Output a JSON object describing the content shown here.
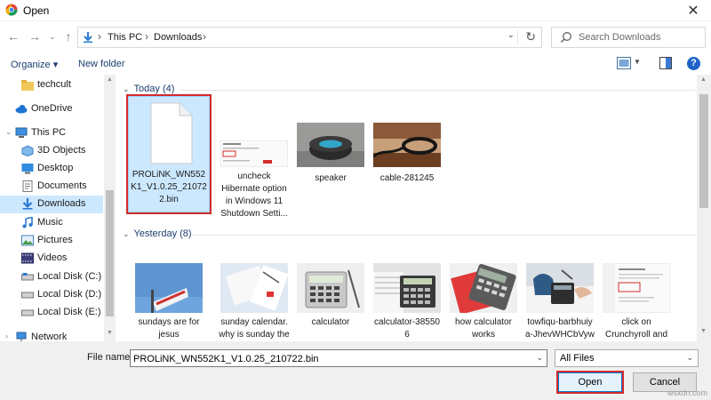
{
  "window": {
    "title": "Open",
    "close_label": "✕"
  },
  "nav": {
    "breadcrumbs": [
      "This PC",
      "Downloads"
    ],
    "search_placeholder": "Search Downloads"
  },
  "toolbar": {
    "organize": "Organize ▾",
    "new_folder": "New folder",
    "help": "?"
  },
  "sidebar": {
    "items": [
      {
        "label": "techcult",
        "icon": "folder-icon"
      },
      {
        "label": "OneDrive",
        "icon": "cloud-icon"
      },
      {
        "label": "This PC",
        "icon": "computer-icon"
      },
      {
        "label": "3D Objects",
        "icon": "cube-icon"
      },
      {
        "label": "Desktop",
        "icon": "desktop-icon"
      },
      {
        "label": "Documents",
        "icon": "document-icon"
      },
      {
        "label": "Downloads",
        "icon": "download-icon",
        "selected": true
      },
      {
        "label": "Music",
        "icon": "music-icon"
      },
      {
        "label": "Pictures",
        "icon": "picture-icon"
      },
      {
        "label": "Videos",
        "icon": "video-icon"
      },
      {
        "label": "Local Disk (C:)",
        "icon": "drive-icon"
      },
      {
        "label": "Local Disk (D:)",
        "icon": "drive-icon"
      },
      {
        "label": "Local Disk (E:)",
        "icon": "drive-icon"
      },
      {
        "label": "Network",
        "icon": "network-icon"
      }
    ]
  },
  "groups": [
    {
      "header": "Today (4)",
      "files": [
        {
          "name": "PROLiNK_WN552K1_V1.0.25_210722.bin",
          "name_lines": [
            "PROLiNK_WN552",
            "K1_V1.0.25_21072",
            "2.bin"
          ],
          "thumb": "file-icon",
          "selected": true
        },
        {
          "name": "uncheck Hibernate option in Windows 11 Shutdown Setti...",
          "name_lines": [
            "uncheck",
            "Hibernate option",
            "in Windows 11",
            "Shutdown Setti..."
          ],
          "thumb": "screenshot-thumbnail"
        },
        {
          "name": "speaker",
          "name_lines": [
            "speaker"
          ],
          "thumb": "speaker-thumbnail"
        },
        {
          "name": "cable-281245",
          "name_lines": [
            "cable-281245"
          ],
          "thumb": "cable-thumbnail"
        }
      ]
    },
    {
      "header": "Yesterday (8)",
      "files": [
        {
          "name": "sundays are for jesus",
          "name_lines": [
            "sundays are for",
            "jesus"
          ],
          "thumb": "sign-thumbnail"
        },
        {
          "name": "sunday calendar. why is sunday the",
          "name_lines": [
            "sunday calendar.",
            "why is sunday the"
          ],
          "thumb": "calendar-thumbnail"
        },
        {
          "name": "calculator",
          "name_lines": [
            "calculator"
          ],
          "thumb": "calculator-thumbnail"
        },
        {
          "name": "calculator-385506",
          "name_lines": [
            "calculator-38550",
            "6"
          ],
          "thumb": "calculator-thumbnail"
        },
        {
          "name": "how calculator works",
          "name_lines": [
            "how calculator",
            "works"
          ],
          "thumb": "calculator-thumbnail"
        },
        {
          "name": "towfiqu-barbhuiya-JhevWHCbVyw",
          "name_lines": [
            "towfiqu-barbhuiy",
            "a-JhevWHCbVyw"
          ],
          "thumb": "calculator-thumbnail"
        },
        {
          "name": "click on Crunchyroll and",
          "name_lines": [
            "click on",
            "Crunchyroll and"
          ],
          "thumb": "screenshot-thumbnail"
        }
      ]
    }
  ],
  "bottom": {
    "file_name_label": "File name:",
    "file_name_value": "PROLiNK_WN552K1_V1.0.25_210722.bin",
    "file_type": "All Files",
    "open_label": "Open",
    "cancel_label": "Cancel"
  },
  "watermark": "wsxdn.com",
  "colors": {
    "selection": "#cce8ff",
    "highlight_red": "#d42b2b",
    "accent_blue": "#0078d7"
  }
}
